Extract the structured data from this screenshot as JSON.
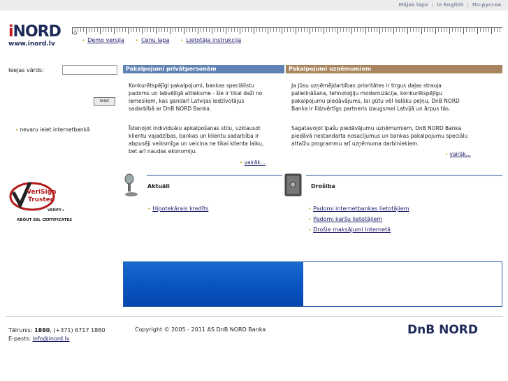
{
  "top_links": [
    "Mājas lapa",
    "in English",
    "По-русски"
  ],
  "logo": {
    "brand_i": "i",
    "brand_rest": "NORD",
    "url": "www.inord.lv"
  },
  "nav": [
    "Demo versija",
    "Cenu lapa",
    "Lietotāja instrukcija"
  ],
  "login": {
    "label": "Ieejas vārds:",
    "value": "",
    "button": "Ieiet",
    "cannot_login": "nevaru ieiet internetbankā"
  },
  "verisign": {
    "line1": "VeriSign",
    "line2": "Trusted",
    "verify": "VERIFY ▸",
    "about": "ABOUT SSL CERTIFICATES"
  },
  "private": {
    "header": "Pakalpojumi privātpersonām",
    "para1": "Konkurētspējīgi pakalpojumi, bankas speciālistu padoms un labvēlīgā attieksme - šie ir tikai daži no iemesliem, kas gandarī Latvijas iedzīvotājus sadarbībā ar DnB NORD Banka.",
    "para2": "Īstenojot individuālu apkalpošanas stilu, uzklausot klientu vajadzības, bankas un klientu sadarbība ir abpusēji veiksmīga un veicina ne tikai klienta laiku, bet arī naudas ekonomiju.",
    "more": "vairāk..."
  },
  "business": {
    "header": "Pakalpojumi uzņēmumiem",
    "para1": "Ja Jūsu uzņēmējdarbības prioritātes ir tirgus daļas strauja palielināšana, tehnoloģiju modernizācija, konkurētspējīgu pakalpojumu piedāvājums, lai gūtu vēl lielāku peļņu, DnB NORD Banka ir līdzvērtīgs partneris izaugsmei Latvijā un ārpus tās.",
    "para2": "Sagatavojot īpašu piedāvājumu uzņēmumiem, DnB NORD Banka piedāvā nestandarta nosacījumus un bankas pakalpojumu speciālu attaīžu programmu arī uzņēmuma darbiniekiem.",
    "more": "vairāk..."
  },
  "news": {
    "title": "Aktuāli",
    "items": [
      "Hipotekārais kredīts"
    ]
  },
  "security": {
    "title": "Drošība",
    "items": [
      "Padomi internetbankas lietotājiem",
      "Padomi karšu lietotājiem",
      "Drošie maksājumi Internetā"
    ]
  },
  "footer": {
    "phone_label": "Tālrunis: ",
    "phone_short": "1880",
    "phone_rest": ", (+371) 6717 1880",
    "email_label": "E-pasts: ",
    "email": "info@inord.lv",
    "copyright": "Copyright © 2005 - 2011 AS DnB NORD Banka",
    "brand": "DnB NORD"
  },
  "colors": {
    "private_header": "#5f82b4",
    "business_header": "#a8855e",
    "banner": "#0a55c0",
    "brand": "#1d2a5a"
  }
}
